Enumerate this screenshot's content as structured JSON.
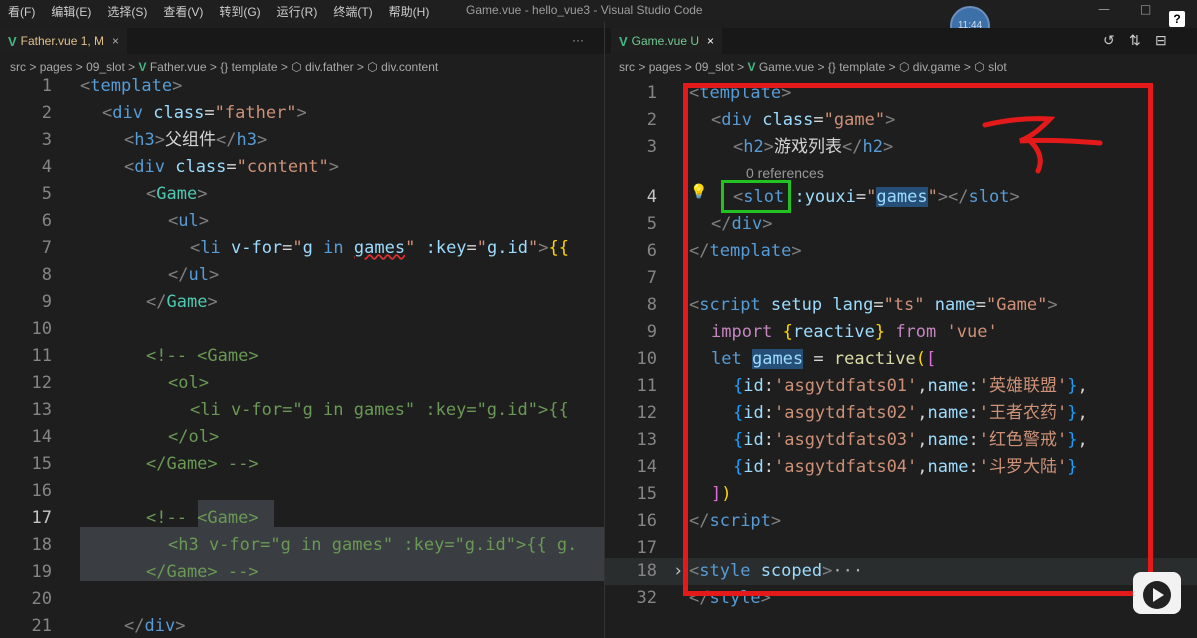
{
  "menu": {
    "items": [
      "看(F)",
      "编辑(E)",
      "选择(S)",
      "查看(V)",
      "转到(G)",
      "运行(R)",
      "终端(T)",
      "帮助(H)"
    ],
    "window_title": "Game.vue - hello_vue3 - Visual Studio Code",
    "help": "?"
  },
  "left": {
    "tab": {
      "icon": "V",
      "label": "Father.vue 1, M",
      "close": "×",
      "more": "···"
    },
    "breadcrumb": [
      "src",
      "pages",
      "09_slot",
      "Father.vue",
      "{} template",
      "div.father",
      "div.content"
    ]
  },
  "right": {
    "tab": {
      "icon": "V",
      "label": "Game.vue U",
      "close": "×"
    },
    "breadcrumb": [
      "src",
      "pages",
      "09_slot",
      "Game.vue",
      "{} template",
      "div.game",
      "slot"
    ],
    "references": "0 references"
  },
  "avatar_time": "11:44",
  "colors": {
    "red_annotation": "#e41a1a",
    "green_annotation": "#21c221"
  }
}
